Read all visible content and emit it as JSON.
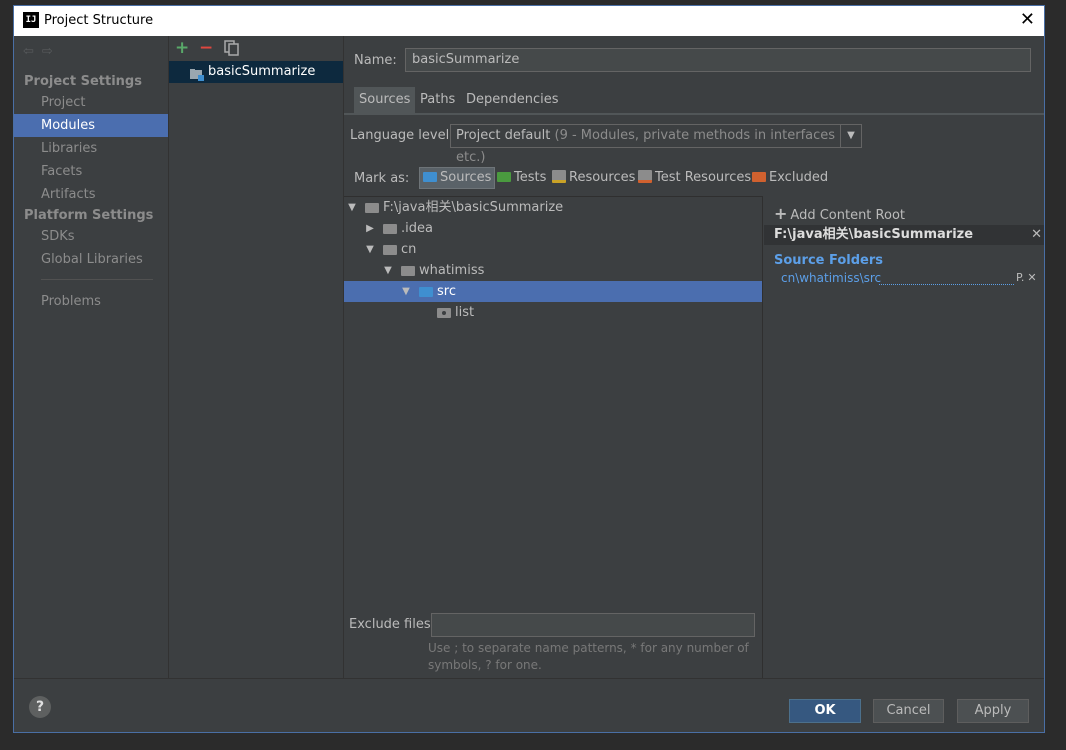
{
  "window": {
    "title": "Project Structure"
  },
  "nav": {
    "back": "⇦",
    "forward": "⇨"
  },
  "sidebar": {
    "project_settings": "Project Settings",
    "platform_settings": "Platform Settings",
    "items": [
      {
        "label": "Project"
      },
      {
        "label": "Modules"
      },
      {
        "label": "Libraries"
      },
      {
        "label": "Facets"
      },
      {
        "label": "Artifacts"
      },
      {
        "label": "SDKs"
      },
      {
        "label": "Global Libraries"
      },
      {
        "label": "Problems"
      }
    ],
    "selected": "Modules"
  },
  "modules": {
    "toolbar": {
      "add": "+",
      "remove": "−"
    },
    "items": [
      {
        "label": "basicSummarize"
      }
    ]
  },
  "module": {
    "name_label": "Name:",
    "name_value": "basicSummarize",
    "tabs": [
      {
        "label": "Sources"
      },
      {
        "label": "Paths"
      },
      {
        "label": "Dependencies"
      }
    ],
    "active_tab": "Sources",
    "language_level_label": "Language level:",
    "language_level_value": "Project default",
    "language_level_detail": "(9 - Modules, private methods in interfaces etc.)",
    "mark_as_label": "Mark as:",
    "mark_as": [
      {
        "label": "Sources",
        "color": "#3f8fd0"
      },
      {
        "label": "Tests",
        "color": "#4a9a3f"
      },
      {
        "label": "Resources",
        "color": "#8c8c8c"
      },
      {
        "label": "Test Resources",
        "color": "#8c8c8c"
      },
      {
        "label": "Excluded",
        "color": "#d0612f"
      }
    ],
    "tree": [
      {
        "label": "F:\\java相关\\basicSummarize",
        "expanded": true
      },
      {
        "label": ".idea",
        "expanded": false
      },
      {
        "label": "cn",
        "expanded": true
      },
      {
        "label": "whatimiss",
        "expanded": true
      },
      {
        "label": "src",
        "expanded": true,
        "selected": true
      },
      {
        "label": "list"
      }
    ],
    "exclude_files_label": "Exclude files:",
    "exclude_files_value": "",
    "exclude_hint": "Use ; to separate name patterns, * for any number of symbols, ? for one."
  },
  "content_root": {
    "add_label": "Add Content Root",
    "path": "F:\\java相关\\basicSummarize",
    "source_folders_label": "Source Folders",
    "source_folders": [
      {
        "label": "cn\\whatimiss\\src"
      }
    ],
    "props_label": "P.",
    "close_glyph": "✕"
  },
  "buttons": {
    "help": "?",
    "ok": "OK",
    "cancel": "Cancel",
    "apply": "Apply"
  },
  "colors": {
    "accent": "#4b6eaf",
    "source_blue": "#5c9fe8",
    "ok_button": "#365880"
  }
}
